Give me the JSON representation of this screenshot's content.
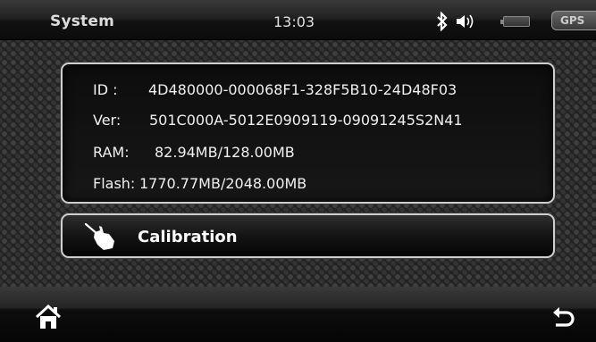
{
  "status_bar": {
    "title": "System",
    "clock": "13:03",
    "gps_label": "GPS",
    "icons": [
      "bluetooth-icon",
      "volume-icon",
      "battery-icon"
    ]
  },
  "system_info": {
    "rows": [
      {
        "label": "ID :",
        "value": "4D480000-000068F1-328F5B10-24D48F03"
      },
      {
        "label": "Ver:",
        "value": "501C000A-5012E0909119-09091245S2N41"
      },
      {
        "label": "RAM:",
        "value": "82.94MB/128.00MB"
      },
      {
        "label": "Flash:",
        "value": "1770.77MB/2048.00MB"
      }
    ]
  },
  "calibration": {
    "label": "Calibration",
    "icon": "stylus-hand-icon"
  },
  "bottom_bar": {
    "home_icon": "home-icon",
    "back_icon": "back-arrow-icon"
  },
  "colors": {
    "text": "#f0f0f0",
    "panel_border": "#cfcfcf",
    "background": "#262626"
  }
}
